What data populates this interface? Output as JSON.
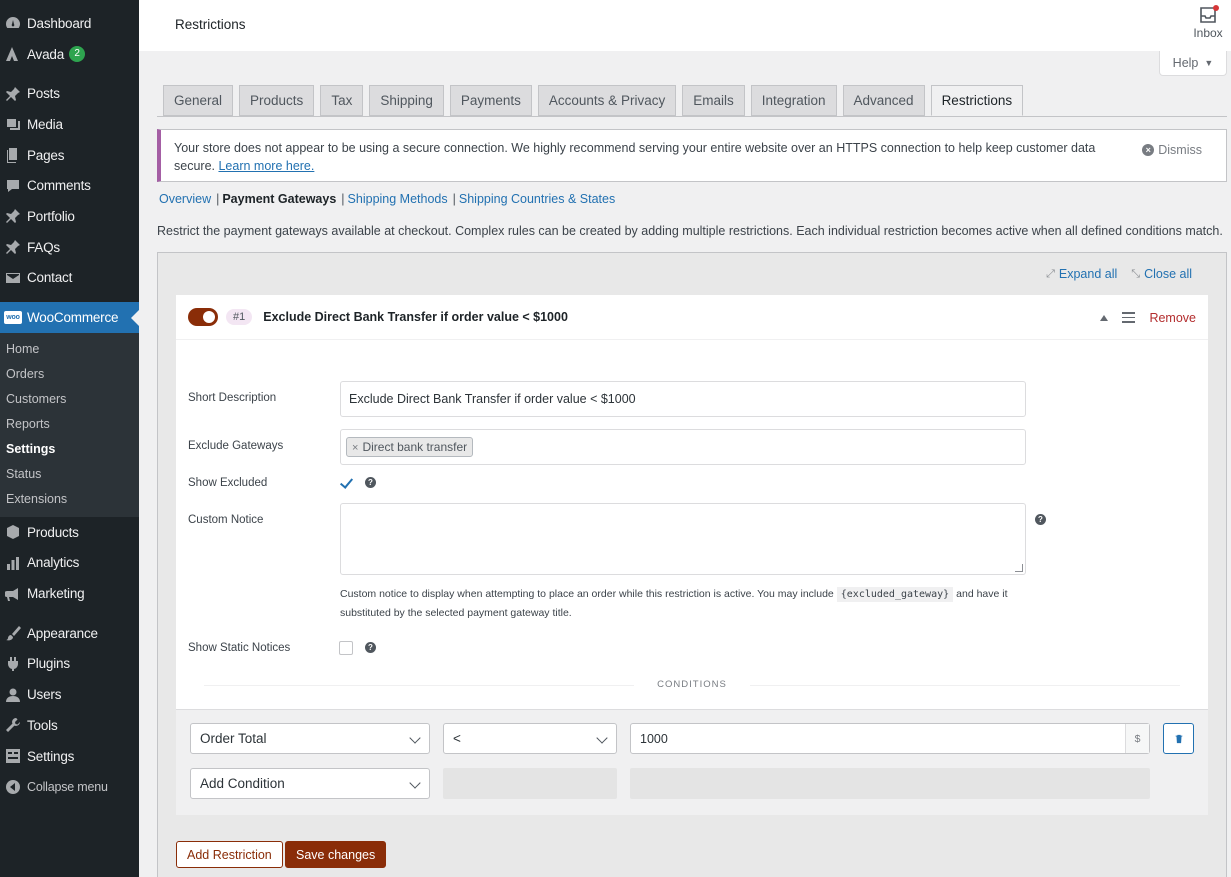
{
  "sidebar": {
    "menu": [
      {
        "label": "Dashboard",
        "icon": "dashboard-icon"
      },
      {
        "label": "Avada",
        "icon": "avada-icon",
        "badge": "2"
      },
      {
        "label": "Posts",
        "icon": "pin-icon"
      },
      {
        "label": "Media",
        "icon": "media-icon"
      },
      {
        "label": "Pages",
        "icon": "pages-icon"
      },
      {
        "label": "Comments",
        "icon": "comments-icon"
      },
      {
        "label": "Portfolio",
        "icon": "pin-icon"
      },
      {
        "label": "FAQs",
        "icon": "pin-icon"
      },
      {
        "label": "Contact",
        "icon": "mail-icon"
      },
      {
        "label": "WooCommerce",
        "icon": "woo-icon"
      }
    ],
    "submenu": [
      "Home",
      "Orders",
      "Customers",
      "Reports",
      "Settings",
      "Status",
      "Extensions"
    ],
    "submenu_active": "Settings",
    "menu2": [
      {
        "label": "Products",
        "icon": "products-icon"
      },
      {
        "label": "Analytics",
        "icon": "analytics-icon"
      },
      {
        "label": "Marketing",
        "icon": "marketing-icon"
      },
      {
        "label": "Appearance",
        "icon": "appearance-icon"
      },
      {
        "label": "Plugins",
        "icon": "plugins-icon"
      },
      {
        "label": "Users",
        "icon": "users-icon"
      },
      {
        "label": "Tools",
        "icon": "tools-icon"
      },
      {
        "label": "Settings",
        "icon": "settings-icon"
      },
      {
        "label": "Collapse menu",
        "icon": "collapse-icon"
      }
    ],
    "woo_logo_text": "woo"
  },
  "header": {
    "title": "Restrictions",
    "inbox_label": "Inbox",
    "help_label": "Help"
  },
  "tabs": [
    "General",
    "Products",
    "Tax",
    "Shipping",
    "Payments",
    "Accounts & Privacy",
    "Emails",
    "Integration",
    "Advanced",
    "Restrictions"
  ],
  "active_tab": "Restrictions",
  "notice": {
    "text": "Your store does not appear to be using a secure connection. We highly recommend serving your entire website over an HTTPS connection to help keep customer data secure. ",
    "link": "Learn more here.",
    "dismiss": "Dismiss"
  },
  "subnav": {
    "overview": "Overview",
    "current": "Payment Gateways",
    "shipping_methods": "Shipping Methods",
    "shipping_countries": "Shipping Countries & States"
  },
  "description": "Restrict the payment gateways available at checkout. Complex rules can be created by adding multiple restrictions. Each individual restriction becomes active when all defined conditions match.",
  "panel": {
    "expand_all": "Expand all",
    "close_all": "Close all"
  },
  "restriction": {
    "number": "#1",
    "title": "Exclude Direct Bank Transfer if order value < $1000",
    "remove": "Remove",
    "short_description_label": "Short Description",
    "short_description_value": "Exclude Direct Bank Transfer if order value < $1000",
    "exclude_gateways_label": "Exclude Gateways",
    "excluded_gateway": "Direct bank transfer",
    "show_excluded_label": "Show Excluded",
    "custom_notice_label": "Custom Notice",
    "custom_notice_help_1": "Custom notice to display when attempting to place an order while this restriction is active. You may include",
    "custom_notice_code": "{excluded_gateway}",
    "custom_notice_help_2": "and have it substituted by the selected payment gateway title.",
    "show_static_label": "Show Static Notices",
    "conditions_label": "CONDITIONS",
    "condition_field": "Order Total",
    "condition_operator": "<",
    "condition_value": "1000",
    "condition_unit": "$",
    "add_condition": "Add Condition"
  },
  "buttons": {
    "add_restriction": "Add Restriction",
    "save_changes": "Save changes"
  },
  "colors": {
    "accent": "#8a2d08",
    "link": "#2271b1",
    "sidebar_bg": "#1d2327",
    "sidebar_current": "#2271b1"
  }
}
